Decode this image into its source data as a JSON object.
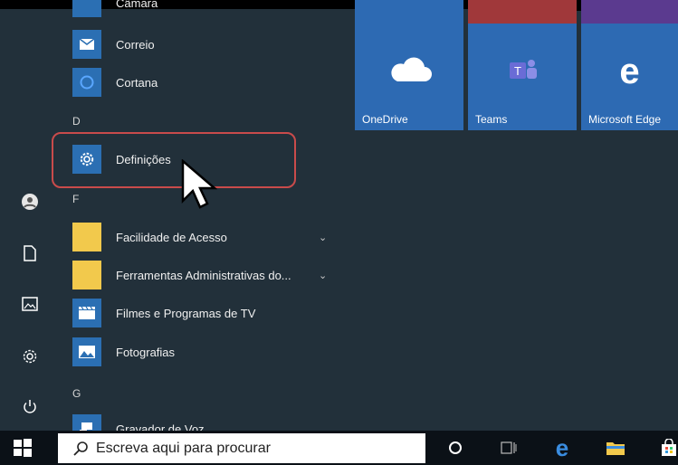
{
  "apps": {
    "partial_top": "Câmara",
    "correio": "Correio",
    "cortana": "Cortana",
    "letter_d": "D",
    "definicoes": "Definições",
    "letter_f": "F",
    "facilidade": "Facilidade de Acesso",
    "ferramentas": "Ferramentas Administrativas do...",
    "filmes": "Filmes e Programas de TV",
    "fotografias": "Fotografias",
    "letter_g": "G",
    "gravador": "Gravador de Voz"
  },
  "tiles": {
    "onedrive": "OneDrive",
    "teams": "Teams",
    "edge": "Microsoft Edge"
  },
  "taskbar": {
    "search_placeholder": "Escreva aqui para procurar"
  },
  "colors": {
    "tile_blue": "#2d6ab3",
    "highlight_red": "#c94b4b",
    "menu_bg": "#22303a"
  }
}
